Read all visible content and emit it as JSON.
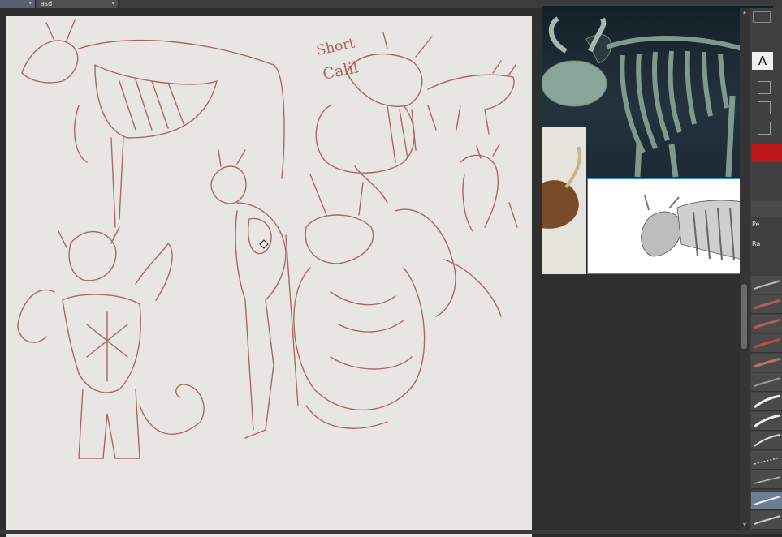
{
  "tabs": [
    {
      "label": ""
    },
    {
      "label": "asd"
    }
  ],
  "canvas_text": {
    "note_line1": "Short",
    "note_line2": "Calil"
  },
  "brush_panel": {
    "label_a": "A",
    "label_pe": "Pe",
    "label_ra": "Ra"
  },
  "colors": {
    "sketch_stroke": "#a0524c",
    "canvas_bg": "#e8e6e3",
    "selected_brush": "#6d7d92",
    "swatch_red": "#c01818"
  }
}
